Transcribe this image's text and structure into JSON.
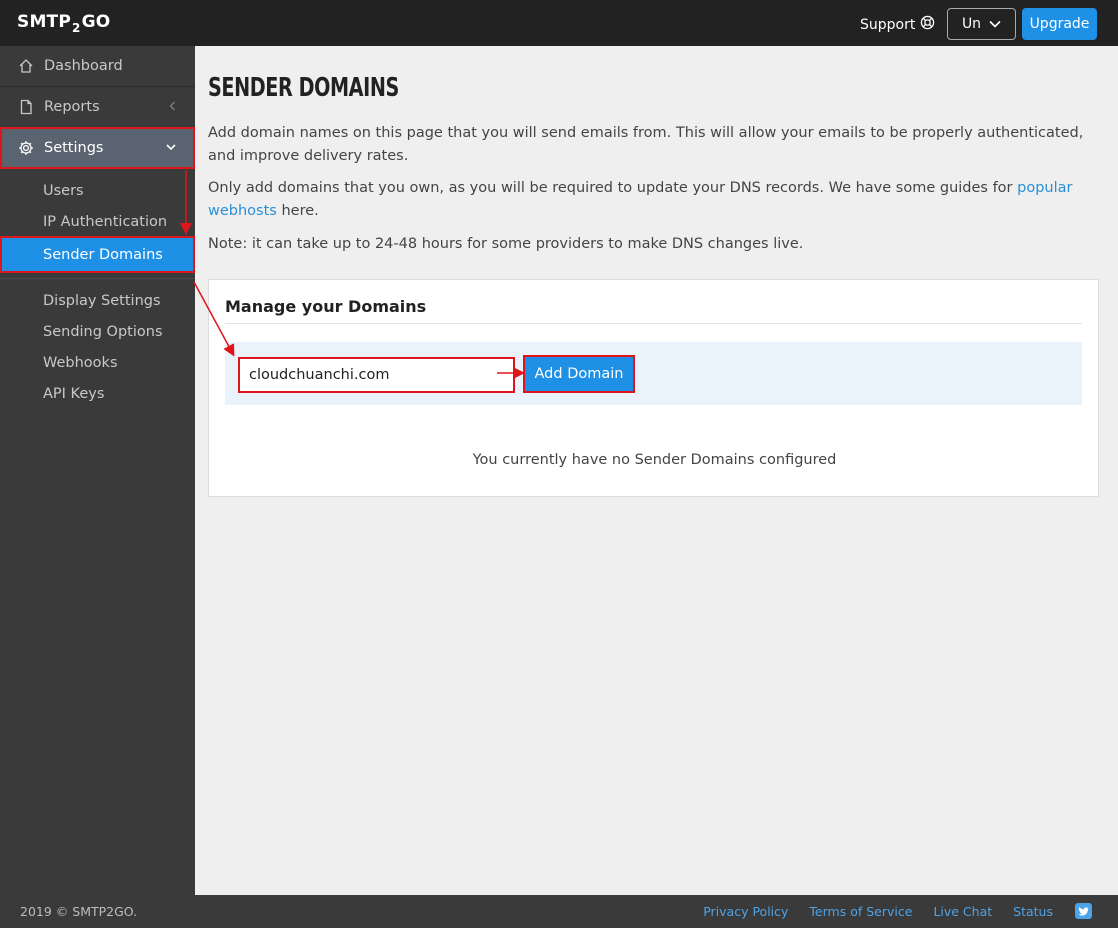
{
  "brand": {
    "logo_left": "SMTP",
    "logo_two": "2",
    "logo_right": "GO"
  },
  "header": {
    "support_label": "Support",
    "user_label": "Un",
    "upgrade_label": "Upgrade"
  },
  "sidebar": {
    "items": [
      {
        "label": "Dashboard",
        "icon": "home-icon"
      },
      {
        "label": "Reports",
        "icon": "document-icon"
      },
      {
        "label": "Settings",
        "icon": "gear-icon"
      }
    ],
    "settings_sub": [
      {
        "label": "Users"
      },
      {
        "label": "IP Authentication"
      },
      {
        "label": "Sender Domains"
      },
      {
        "label": "Display Settings"
      },
      {
        "label": "Sending Options"
      },
      {
        "label": "Webhooks"
      },
      {
        "label": "API Keys"
      }
    ]
  },
  "main": {
    "title": "SENDER DOMAINS",
    "para1": "Add domain names on this page that you will send emails from. This will allow your emails to be properly authenticated, and improve delivery rates.",
    "para2_before": "Only add domains that you own, as you will be required to update your DNS records. We have some guides for ",
    "para2_link": "popular webhosts",
    "para2_after": " here.",
    "para3": "Note: it can take up to 24-48 hours for some providers to make DNS changes live.",
    "panel": {
      "title": "Manage your Domains",
      "input_value": "cloudchuanchi.com",
      "add_button": "Add Domain",
      "empty_message": "You currently have no Sender Domains configured"
    }
  },
  "footer": {
    "copyright": "2019 © SMTP2GO.",
    "links": [
      "Privacy Policy",
      "Terms of Service",
      "Live Chat",
      "Status"
    ]
  },
  "colors": {
    "accent": "#1e90e6",
    "annotation": "#e0151b",
    "sidebar": "#3a3a3a",
    "topbar": "#222222"
  }
}
